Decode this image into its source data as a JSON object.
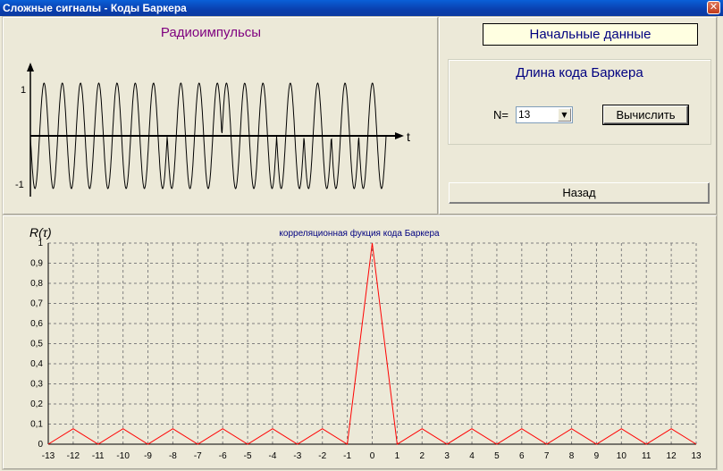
{
  "window": {
    "title": "Сложные сигналы - Коды Баркера",
    "close_symbol": "✕"
  },
  "radio_panel": {
    "title": "Радиоимпульсы",
    "axis_t": "t",
    "tick_top": "1",
    "tick_bottom": "-1"
  },
  "settings": {
    "initial_data": "Начальные данные",
    "group_title": "Длина кода Баркера",
    "n_label": "N=",
    "n_value": "13",
    "calc_button": "Вычислить",
    "back_button": "Назад"
  },
  "colors": {
    "title_purple": "#7f007f",
    "group_blue": "#000080",
    "correlation_line": "#ff0000"
  },
  "chart_data": {
    "type": "line",
    "title": "корреляционная фукция кода Баркера",
    "ylabel": "R(τ)",
    "xlabel": "",
    "grid": true,
    "xlim": [
      -13,
      13
    ],
    "ylim": [
      0,
      1
    ],
    "x_ticks": [
      "-13",
      "-12",
      "-11",
      "-10",
      "-9",
      "-8",
      "-7",
      "-6",
      "-5",
      "-4",
      "-3",
      "-2",
      "-1",
      "0",
      "1",
      "2",
      "3",
      "4",
      "5",
      "6",
      "7",
      "8",
      "9",
      "10",
      "11",
      "12",
      "13"
    ],
    "y_ticks": [
      "0",
      "0,1",
      "0,2",
      "0,3",
      "0,4",
      "0,5",
      "0,6",
      "0,7",
      "0,8",
      "0,9",
      "1"
    ],
    "series": [
      {
        "x": [
          -13,
          -12,
          -11,
          -10,
          -9,
          -8,
          -7,
          -6,
          -5,
          -4,
          -3,
          -2,
          -1,
          0,
          1,
          2,
          3,
          4,
          5,
          6,
          7,
          8,
          9,
          10,
          11,
          12,
          13
        ],
        "y": [
          0,
          0.077,
          0,
          0.077,
          0,
          0.077,
          0,
          0.077,
          0,
          0.077,
          0,
          0.077,
          0,
          1,
          0,
          0.077,
          0,
          0.077,
          0,
          0.077,
          0,
          0.077,
          0,
          0.077,
          0,
          0.077,
          0
        ]
      }
    ]
  }
}
